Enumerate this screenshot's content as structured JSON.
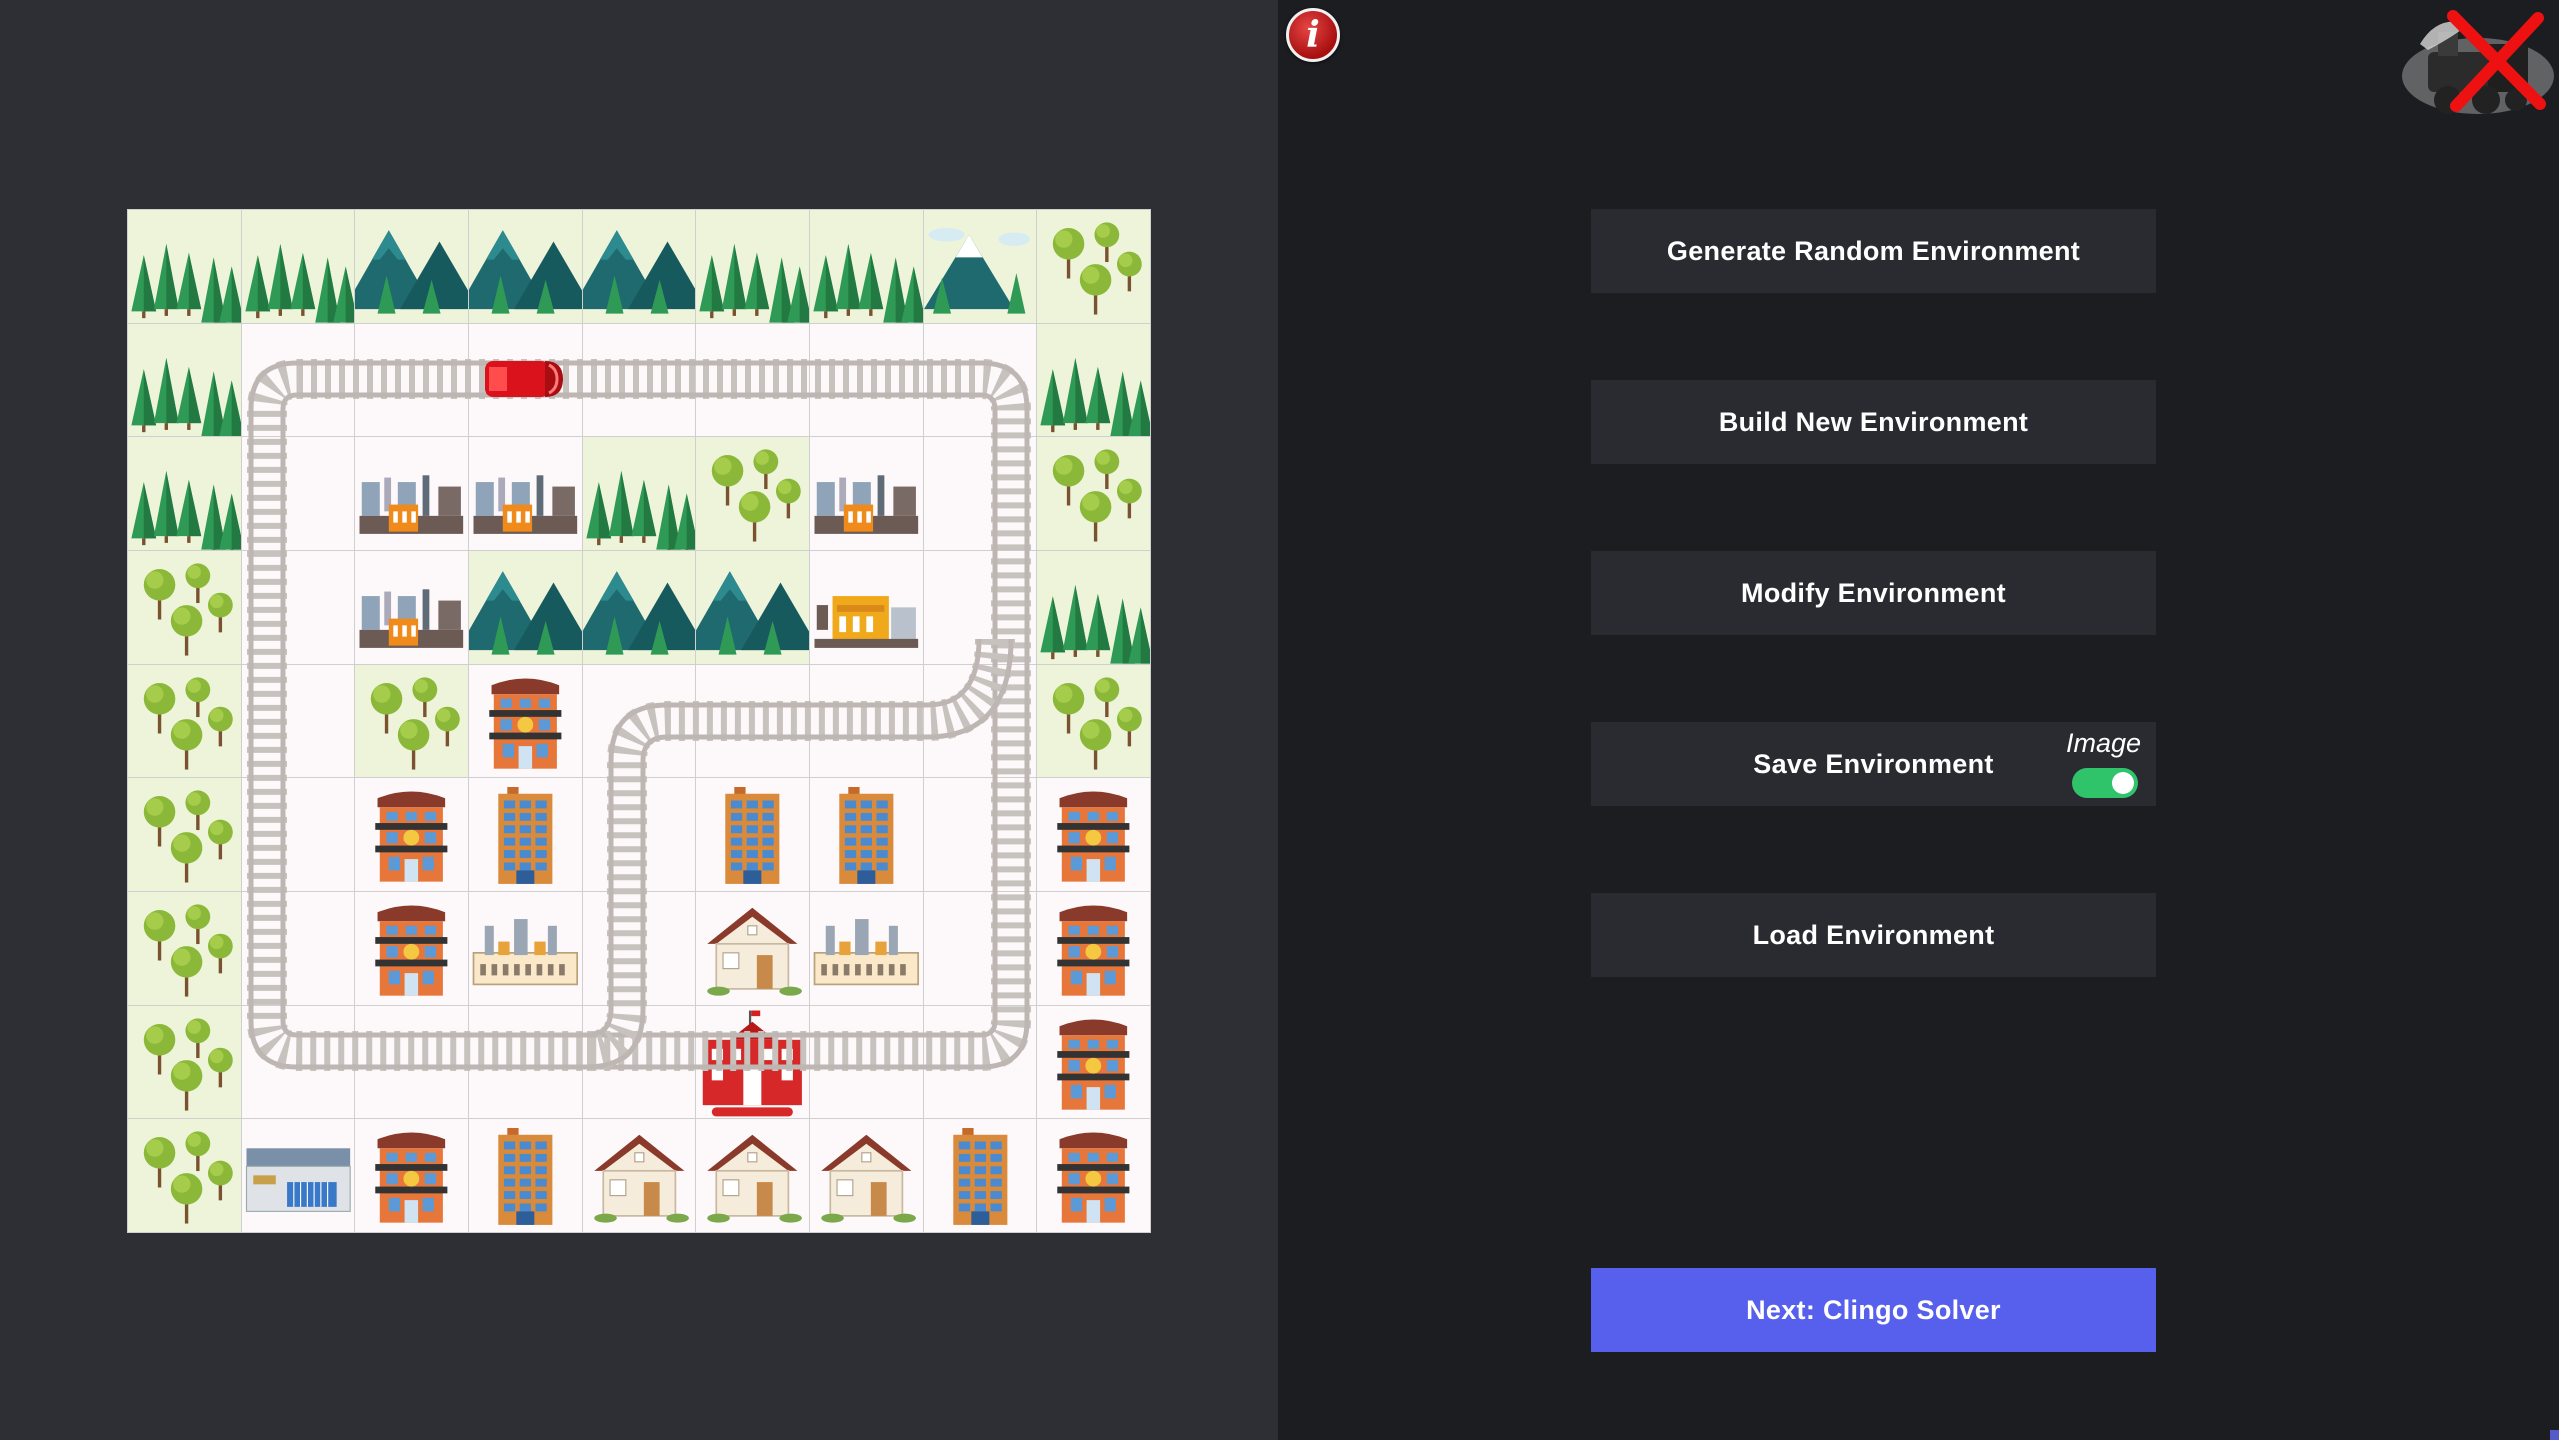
{
  "info_button": {
    "glyph": "i",
    "icon": "info-icon"
  },
  "close_button": {
    "icon": "train-close-icon"
  },
  "buttons": {
    "generate": "Generate Random Environment",
    "build": "Build New Environment",
    "modify": "Modify Environment",
    "save": "Save Environment",
    "load": "Load Environment",
    "next": "Next: Clingo Solver"
  },
  "image_toggle": {
    "label": "Image",
    "on": true
  },
  "colors": {
    "accent": "#5760ec",
    "toggle_on": "#2fc36a",
    "info": "#c81e1e",
    "train": "#d9121b"
  },
  "grid": {
    "rows": 9,
    "cols": 9,
    "cells": [
      [
        "pine",
        "pine",
        "mountain",
        "mountain",
        "mountain",
        "pine",
        "pine",
        "mountain-snow",
        "tree"
      ],
      [
        "pine",
        "empty",
        "empty",
        "empty",
        "empty",
        "empty",
        "empty",
        "empty",
        "pine"
      ],
      [
        "pine",
        "empty",
        "factory",
        "factory",
        "pine",
        "tree",
        "factory",
        "empty",
        "tree"
      ],
      [
        "tree",
        "empty",
        "factory",
        "mountain",
        "mountain",
        "mountain",
        "factory-yellow",
        "empty",
        "pine"
      ],
      [
        "tree",
        "empty",
        "tree",
        "hotel",
        "empty",
        "empty",
        "empty",
        "empty",
        "tree"
      ],
      [
        "tree",
        "empty",
        "hotel",
        "office",
        "empty",
        "office",
        "office",
        "empty",
        "hotel"
      ],
      [
        "tree",
        "empty",
        "hotel",
        "plant",
        "empty",
        "house",
        "plant",
        "empty",
        "hotel"
      ],
      [
        "tree",
        "empty",
        "empty",
        "empty",
        "empty",
        "school",
        "empty",
        "empty",
        "hotel"
      ],
      [
        "tree",
        "warehouse",
        "hotel",
        "office",
        "house",
        "house",
        "house",
        "office",
        "hotel"
      ]
    ],
    "train": {
      "row": 1,
      "col": 3,
      "icon": "train-icon"
    }
  }
}
